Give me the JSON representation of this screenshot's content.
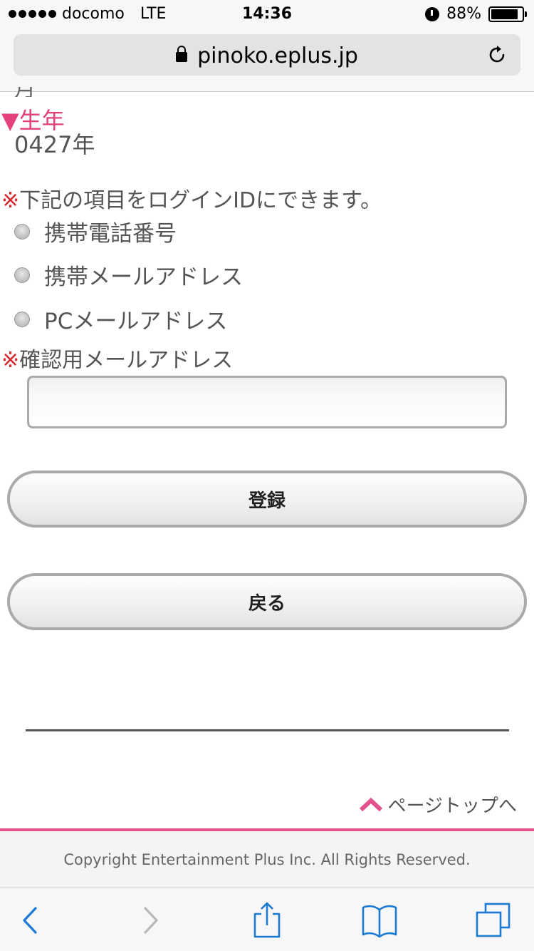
{
  "status_bar": {
    "carrier": "docomo",
    "network": "LTE",
    "time": "14:36",
    "battery": "88%",
    "battery_level": 0.88
  },
  "browser": {
    "url": "pinoko.eplus.jp"
  },
  "form": {
    "birth_year_label": "生年",
    "birth_year_marker": "▼",
    "birth_year_value": "0427年",
    "login_note_mark": "※",
    "login_note": "下記の項目をログインIDにできます。",
    "login_options": [
      "携帯電話番号",
      "携帯メールアドレス",
      "PCメールアドレス"
    ],
    "confirm_email_mark": "※",
    "confirm_email_label": "確認用メールアドレス",
    "confirm_email_value": "",
    "submit_label": "登録",
    "back_label": "戻る"
  },
  "footer": {
    "page_top_label": "ページトップへ",
    "copyright": "Copyright Entertainment Plus Inc. All Rights Reserved."
  },
  "colors": {
    "accent_pink": "#e4407b",
    "required_red": "#d8282e",
    "ios_blue": "#1a7ad4"
  }
}
